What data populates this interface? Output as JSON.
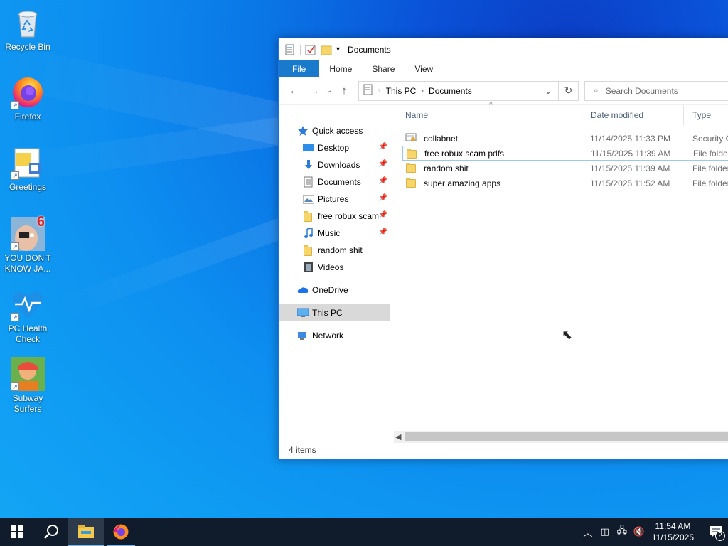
{
  "desktop": {
    "icons": [
      {
        "label": "Recycle Bin"
      },
      {
        "label": "Firefox"
      },
      {
        "label": "Greetings"
      },
      {
        "label": "YOU DON'T KNOW JA..."
      },
      {
        "label": "PC Health Check"
      },
      {
        "label": "Subway Surfers"
      }
    ],
    "badge": "6"
  },
  "window": {
    "title": "Documents",
    "ribbon": {
      "file": "File",
      "home": "Home",
      "share": "Share",
      "view": "View"
    },
    "address": {
      "crumbs": [
        "This PC",
        "Documents"
      ]
    },
    "search": {
      "placeholder": "Search Documents"
    },
    "nav": {
      "quick_access": "Quick access",
      "items": [
        {
          "label": "Desktop"
        },
        {
          "label": "Downloads"
        },
        {
          "label": "Documents"
        },
        {
          "label": "Pictures"
        },
        {
          "label": "free robux scam"
        },
        {
          "label": "Music"
        },
        {
          "label": "random shit"
        },
        {
          "label": "Videos"
        }
      ],
      "onedrive": "OneDrive",
      "this_pc": "This PC",
      "network": "Network"
    },
    "columns": {
      "name": "Name",
      "date": "Date modified",
      "type": "Type"
    },
    "files": [
      {
        "name": "collabnet",
        "date": "11/14/2025 11:33 PM",
        "type": "Security C"
      },
      {
        "name": "free robux scam pdfs",
        "date": "11/15/2025 11:39 AM",
        "type": "File folder"
      },
      {
        "name": "random shit",
        "date": "11/15/2025 11:39 AM",
        "type": "File folder"
      },
      {
        "name": "super amazing apps",
        "date": "11/15/2025 11:52 AM",
        "type": "File folder"
      }
    ],
    "status": "4 items"
  },
  "taskbar": {
    "time": "11:54 AM",
    "date": "11/15/2025",
    "notification_count": "2"
  }
}
